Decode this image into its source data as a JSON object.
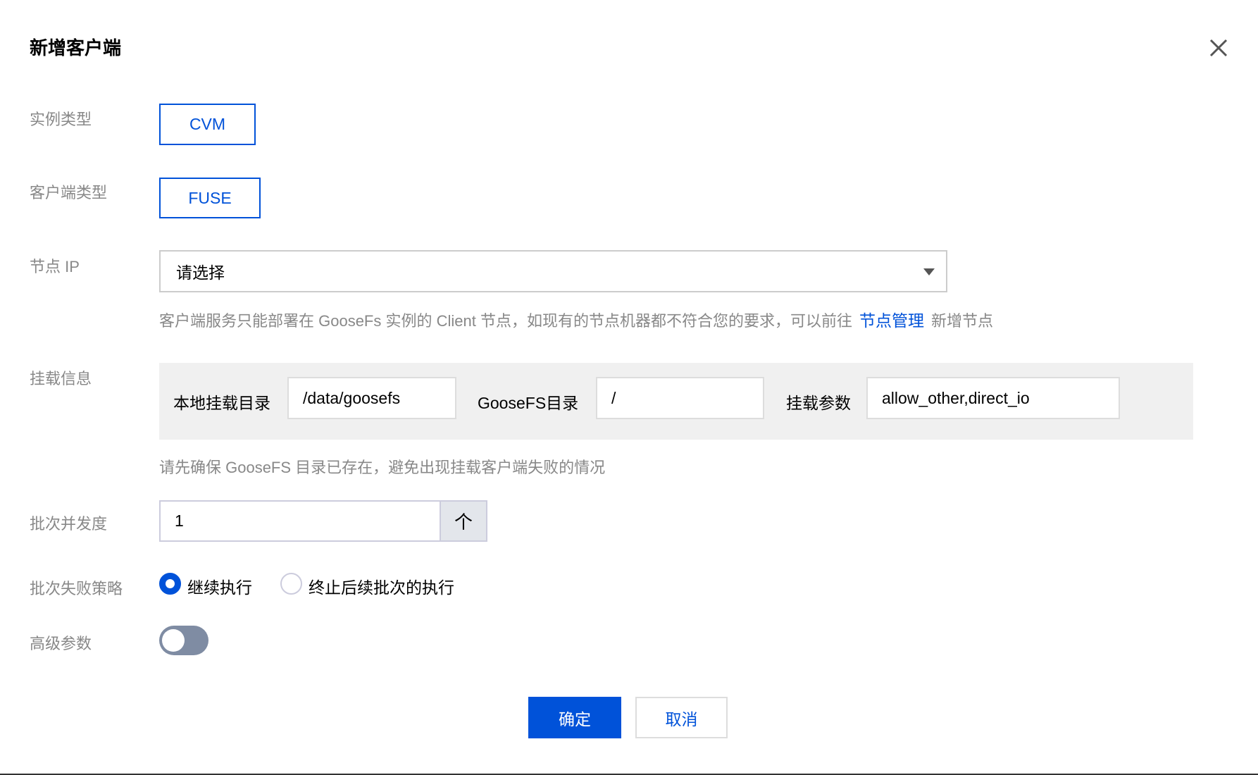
{
  "dialog": {
    "title": "新增客户端"
  },
  "form": {
    "instance_type": {
      "label": "实例类型",
      "value": "CVM"
    },
    "client_type": {
      "label": "客户端类型",
      "value": "FUSE"
    },
    "node_ip": {
      "label": "节点 IP",
      "placeholder": "请选择",
      "hint_before": "客户端服务只能部署在 GooseFs 实例的 Client 节点，如现有的节点机器都不符合您的要求，可以前往",
      "hint_link": "节点管理",
      "hint_after": "新增节点"
    },
    "mount": {
      "label": "挂载信息",
      "local_dir_label": "本地挂载目录",
      "local_dir_value": "/data/goosefs",
      "goosefs_dir_label": "GooseFS目录",
      "goosefs_dir_value": "/",
      "params_label": "挂载参数",
      "params_value": "allow_other,direct_io",
      "hint": "请先确保 GooseFS 目录已存在，避免出现挂载客户端失败的情况"
    },
    "concurrency": {
      "label": "批次并发度",
      "value": "1",
      "up_symbol": "个"
    },
    "failure_policy": {
      "label": "批次失败策略",
      "options": [
        {
          "label": "继续执行",
          "selected": true
        },
        {
          "label": "终止后续批次的执行",
          "selected": false
        }
      ]
    },
    "advanced": {
      "label": "高级参数",
      "enabled": false
    }
  },
  "footer": {
    "confirm": "确定",
    "cancel": "取消"
  },
  "colors": {
    "primary": "#0052d9",
    "label": "#888888"
  }
}
